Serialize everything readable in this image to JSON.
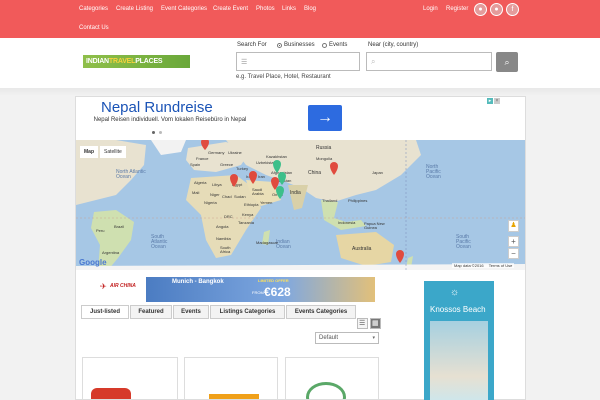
{
  "nav": {
    "items": [
      "Categories",
      "Create Listing",
      "Event Categories",
      "Create Event",
      "Photos",
      "Links",
      "Blog"
    ],
    "second_row": "Contact Us",
    "login": "Login",
    "register": "Register"
  },
  "social": [
    "rss-icon",
    "rss-icon",
    "facebook-icon"
  ],
  "logo": {
    "part1": "INDIAN",
    "part2": "TRAVEL",
    "part3": "PLACES"
  },
  "search": {
    "search_for_label": "Search For",
    "opt_businesses": "Businesses",
    "opt_events": "Events",
    "near_label": "Near (city, country)",
    "hint": "e.g. Travel Place, Hotel, Restaurant"
  },
  "ad_top": {
    "title": "Nepal Rundreise",
    "desc": "Nepal Reisen individuell. Vom lokalen Reisebüro in Nepal",
    "arrow": "→"
  },
  "map": {
    "tab_map": "Map",
    "tab_satellite": "Satellite",
    "zoom_in": "+",
    "zoom_out": "−",
    "google": "Google",
    "attribution": "Map data ©2016",
    "terms": "Terms of Use",
    "labels": {
      "north_atlantic": "North Atlantic Ocean",
      "south_atlantic": "South Atlantic Ocean",
      "indian": "Indian Ocean",
      "north_pacific": "North Pacific Ocean",
      "south_pacific": "South Pacific Ocean",
      "brazil": "Brazil",
      "peru": "Peru",
      "argentina": "Argentina",
      "china": "China",
      "india": "India",
      "russia": "Russia",
      "mongolia": "Mongolia",
      "australia": "Australia",
      "kazakhstan": "Kazakhstan",
      "iran": "Iran",
      "turkey": "Turkey",
      "libya": "Libya",
      "algeria": "Algeria",
      "egypt": "Egypt",
      "sudan": "Sudan",
      "niger": "Niger",
      "nigeria": "Nigeria",
      "saudi_arabia": "Saudi Arabia",
      "ethiopia": "Ethiopia",
      "drc": "DRC",
      "tanzania": "Tanzania",
      "angola": "Angola",
      "namibia": "Namibia",
      "south_africa": "South Africa",
      "madagascar": "Madagascar",
      "germany": "Germany",
      "ukraine": "Ukraine",
      "japan": "Japan",
      "philippines": "Philippines",
      "thailand": "Thailand",
      "indonesia": "Indonesia",
      "papua": "Papua New Guinea",
      "kenya": "Kenya",
      "greece": "Greece",
      "spain": "Spain",
      "france": "France",
      "pakistan": "Pakistan",
      "afghanistan": "Afghanistan",
      "uzbekistan": "Uzbekistan",
      "iraq": "Iraq",
      "mali": "Mali",
      "chad": "Chad",
      "oman": "Oman",
      "yemen": "Yemen"
    }
  },
  "ad_banner": {
    "airline": "AIR CHINA",
    "route": "Munich - Bangkok",
    "offer": "LIMITED OFFER",
    "from": "FROM",
    "price": "€628"
  },
  "tabs": [
    "Just-listed",
    "Featured",
    "Events",
    "Listings Categories",
    "Events Categories"
  ],
  "sort": {
    "selected": "Default"
  },
  "side_ad": {
    "title": "Knossos Beach"
  },
  "colors": {
    "nav_bg": "#f15a5a",
    "accent": "#2d6be0"
  }
}
